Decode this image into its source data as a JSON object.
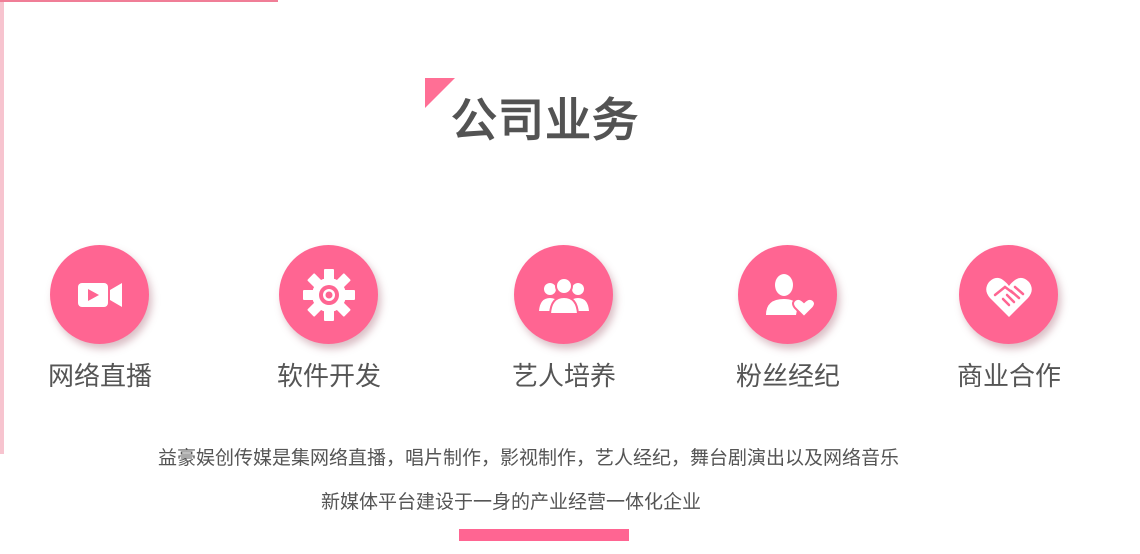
{
  "section": {
    "title": "公司业务"
  },
  "services": [
    {
      "label": "网络直播",
      "icon": "video-camera-icon"
    },
    {
      "label": "软件开发",
      "icon": "gear-icon"
    },
    {
      "label": "艺人培养",
      "icon": "group-people-icon"
    },
    {
      "label": "粉丝经纪",
      "icon": "user-heart-icon"
    },
    {
      "label": "商业合作",
      "icon": "handshake-heart-icon"
    }
  ],
  "description": {
    "line1": "益豪娱创传媒是集网络直播，唱片制作，影视制作，艺人经纪，舞台剧演出以及网络音乐",
    "line2": "新媒体平台建设于一身的产业经营一体化企业"
  },
  "colors": {
    "accent": "#ff6592",
    "title": "#535353",
    "text": "#555555",
    "left_bar": "#f7c4cf"
  }
}
